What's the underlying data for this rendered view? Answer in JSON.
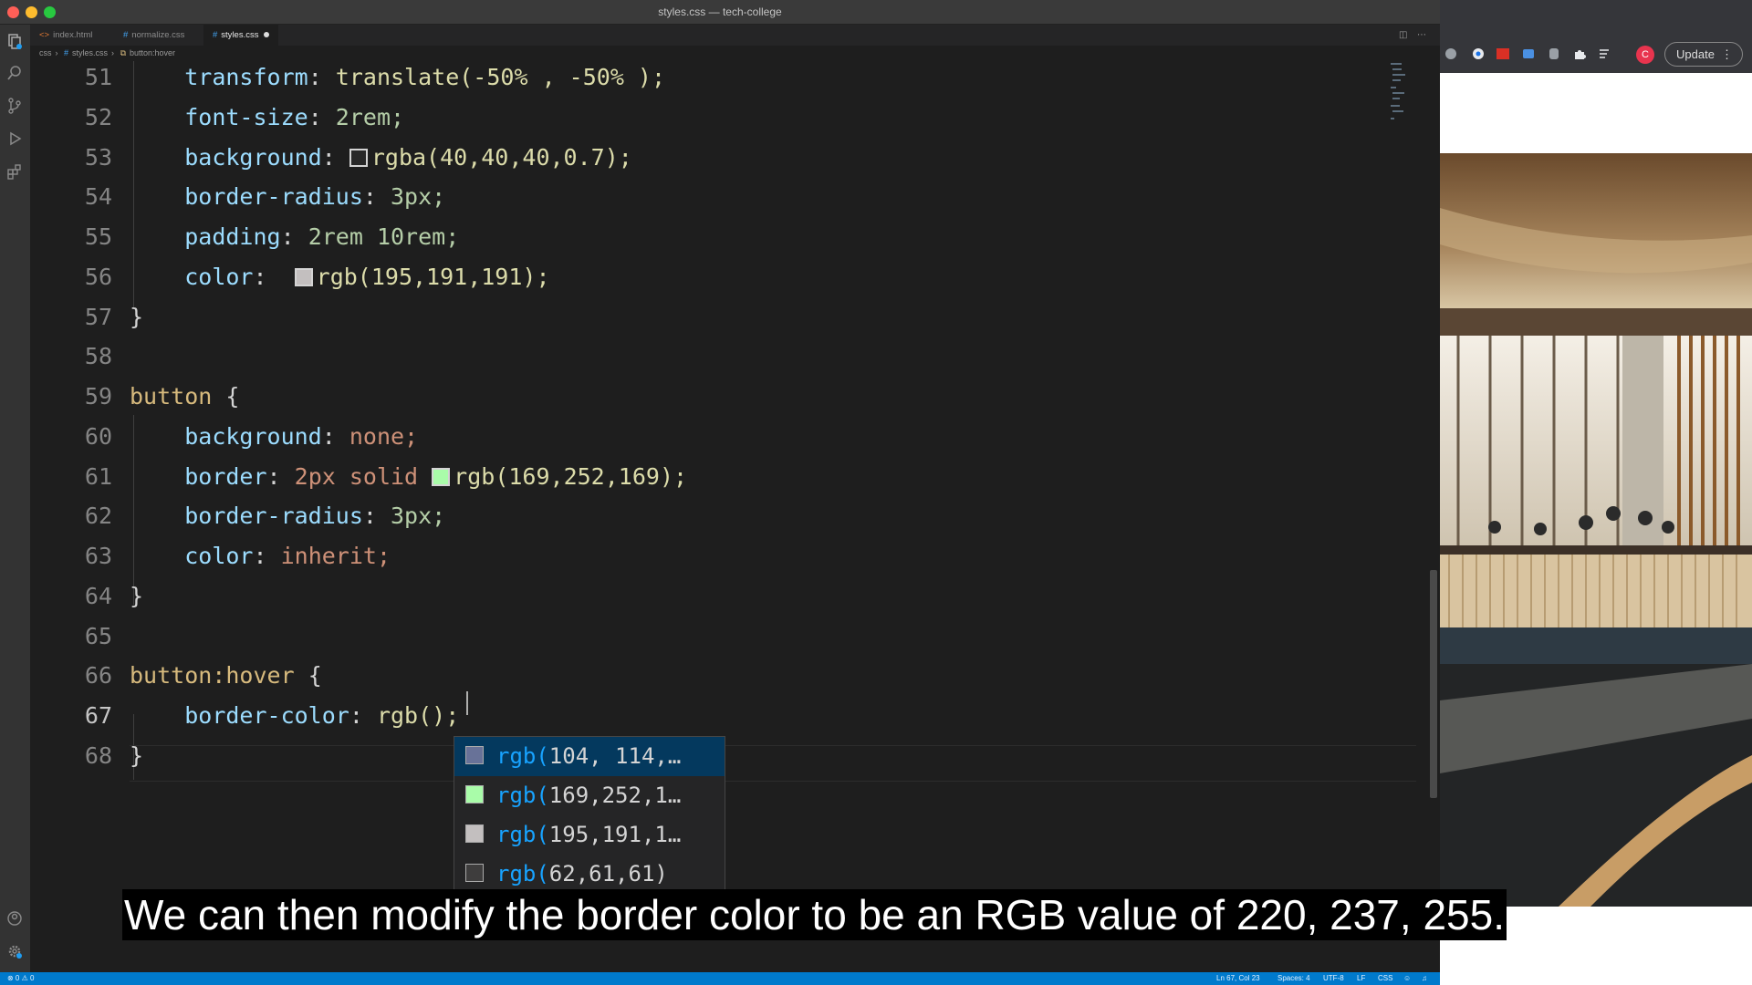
{
  "window": {
    "title": "styles.css — tech-college"
  },
  "tabs": [
    {
      "label": "index.html",
      "icon": "html-icon",
      "active": false,
      "modified": false
    },
    {
      "label": "normalize.css",
      "icon": "css-icon",
      "active": false,
      "modified": false
    },
    {
      "label": "styles.css",
      "icon": "css-icon",
      "active": true,
      "modified": true
    }
  ],
  "breadcrumb": [
    "css",
    "styles.css",
    "button:hover"
  ],
  "editor": {
    "line_numbers": [
      "51",
      "52",
      "53",
      "54",
      "55",
      "56",
      "57",
      "58",
      "59",
      "60",
      "61",
      "62",
      "63",
      "64",
      "65",
      "66",
      "67",
      "68"
    ],
    "current_line": "67",
    "lines": {
      "l51": {
        "prop": "transform",
        "value": "translate(-50% , -50% );"
      },
      "l52": {
        "prop": "font-size",
        "value": "2rem;"
      },
      "l53": {
        "prop": "background",
        "value": "rgba(40,40,40,0.7);",
        "swatch": "#282828"
      },
      "l54": {
        "prop": "border-radius",
        "value": "3px;"
      },
      "l55": {
        "prop": "padding",
        "value": "2rem 10rem;"
      },
      "l56": {
        "prop": "color",
        "value": "rgb(195,191,191);",
        "swatch": "#c3bfbf"
      },
      "l57": {
        "text": "}"
      },
      "l59": {
        "selector": "button",
        "brace": "{"
      },
      "l60": {
        "prop": "background",
        "value": "none;"
      },
      "l61": {
        "prop": "border",
        "value_pre": "2px solid",
        "value": "rgb(169,252,169);",
        "swatch": "#a9fca9"
      },
      "l62": {
        "prop": "border-radius",
        "value": "3px;"
      },
      "l63": {
        "prop": "color",
        "value": "inherit;"
      },
      "l64": {
        "text": "}"
      },
      "l66": {
        "selector": "button:hover",
        "brace": "{"
      },
      "l67": {
        "prop": "border-color",
        "value": "rgb();"
      },
      "l68": {
        "text": "}"
      }
    }
  },
  "suggestions": [
    {
      "match": "rgb(",
      "rest": "104, 114,…",
      "swatch": "#687298",
      "selected": true
    },
    {
      "match": "rgb(",
      "rest": "169,252,1…",
      "swatch": "#a9fca9",
      "selected": false
    },
    {
      "match": "rgb(",
      "rest": "195,191,1…",
      "swatch": "#c3bfbf",
      "selected": false
    },
    {
      "match": "rgb(",
      "rest": "62,61,61)",
      "swatch": "#3e3d3d",
      "selected": false
    }
  ],
  "statusbar": {
    "problems": "⊗ 0 ⚠ 0",
    "position": "Ln 67, Col 23",
    "spaces": "Spaces: 4",
    "encoding": "UTF-8",
    "eol": "LF",
    "language": "CSS"
  },
  "browser": {
    "update_label": "Update",
    "profile_initial": "C"
  },
  "subtitle": "We can then modify the border color to be an RGB value of 220, 237, 255.",
  "colors": {
    "accent": "#007acc",
    "editor_bg": "#1e1e1e",
    "property": "#9cdcfe",
    "selector": "#d7ba7d",
    "number": "#b5cea8"
  }
}
